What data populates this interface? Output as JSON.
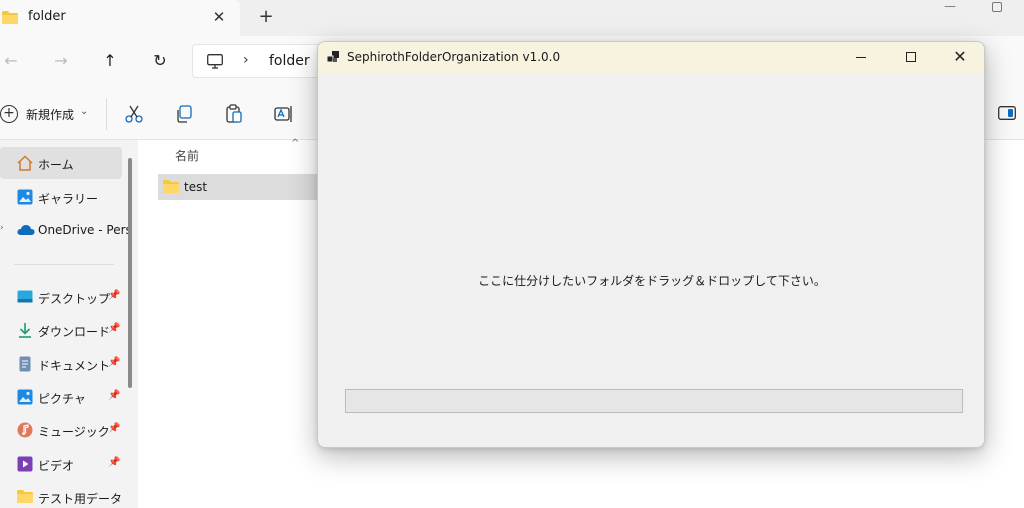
{
  "explorer": {
    "tab_title": "folder",
    "tab_close": "✕",
    "new_tab": "+",
    "address": {
      "separator": "›",
      "path": "folder"
    },
    "toolbar": {
      "new_label": "新規作成",
      "new_chevron": "⌄"
    },
    "sidebar": {
      "items": [
        {
          "label": "ホーム",
          "icon": "home-icon",
          "pinned": false
        },
        {
          "label": "ギャラリー",
          "icon": "gallery-icon",
          "pinned": false
        },
        {
          "label": "OneDrive - Pers",
          "icon": "onedrive-cloud-icon",
          "pinned": false
        },
        {
          "label": "デスクトップ",
          "icon": "desktop-icon",
          "pinned": true
        },
        {
          "label": "ダウンロード",
          "icon": "download-icon",
          "pinned": true
        },
        {
          "label": "ドキュメント",
          "icon": "document-icon",
          "pinned": true
        },
        {
          "label": "ピクチャ",
          "icon": "pictures-icon",
          "pinned": true
        },
        {
          "label": "ミュージック",
          "icon": "music-icon",
          "pinned": true
        },
        {
          "label": "ビデオ",
          "icon": "video-icon",
          "pinned": true
        },
        {
          "label": "テスト用データ",
          "icon": "folder-icon",
          "pinned": false
        }
      ],
      "pin_glyph": "📌"
    },
    "file_list": {
      "column_name": "名前",
      "sort_caret": "^",
      "rows": [
        {
          "name": "test",
          "icon": "folder-icon"
        }
      ]
    }
  },
  "dialog": {
    "title": "SephirothFolderOrganization v1.0.0",
    "close_glyph": "✕",
    "message": "ここに仕分けしたいフォルダをドラッグ＆ドロップして下さい。",
    "progress_percent": 0
  },
  "colors": {
    "dialog_title_bg": "#f7f3df",
    "dialog_body_bg": "#f0f0f0",
    "folder_yellow": "#f5c842",
    "onedrive_blue": "#0f6cbd",
    "progress_fill": "#06b025"
  }
}
